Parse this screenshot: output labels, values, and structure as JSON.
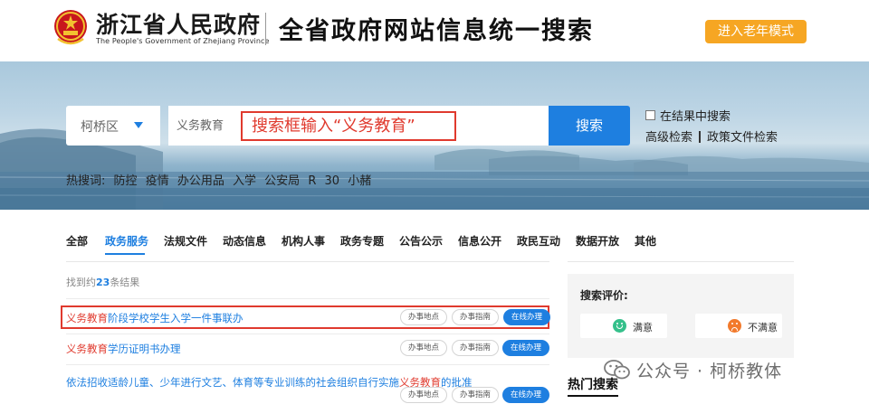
{
  "header": {
    "gov_name": "浙江省人民政府",
    "gov_name_en": "The People's Government of Zhejiang Province",
    "site_title": "全省政府网站信息统一搜索",
    "elder_mode_label": "进入老年模式"
  },
  "search": {
    "district": "柯桥区",
    "value": "义务教育",
    "annotation": "搜索框输入“义务教育”",
    "button_label": "搜索",
    "in_results_label": "在结果中搜索",
    "advanced_label": "高级检索",
    "policy_label": "政策文件检索"
  },
  "hot_words": {
    "label": "热搜词:",
    "items": [
      "防控",
      "疫情",
      "办公用品",
      "入学",
      "公安局",
      "R",
      "30",
      "小赭"
    ]
  },
  "tabs": {
    "items": [
      "全部",
      "政务服务",
      "法规文件",
      "动态信息",
      "机构人事",
      "政务专题",
      "公告公示",
      "信息公开",
      "政民互动",
      "数据开放",
      "其他"
    ],
    "active": "政务服务"
  },
  "results": {
    "count_prefix": "找到约",
    "count": "23",
    "count_suffix": "条结果",
    "items": [
      {
        "highlight": "义务教育",
        "rest": "阶段学校学生入学一件事联办",
        "before": ""
      },
      {
        "highlight": "义务教育",
        "rest": "学历证明书办理",
        "before": ""
      },
      {
        "highlight": "义务教育",
        "rest": "的批准",
        "before": "依法招收适龄儿童、少年进行文艺、体育等专业训练的社会组织自行实施"
      }
    ],
    "actions": [
      "办事地点",
      "办事指南",
      "在线办理"
    ]
  },
  "side": {
    "rating_title": "搜索评价:",
    "satisfied": "满意",
    "unsatisfied": "不满意",
    "hot_search_title": "热门搜索"
  },
  "watermark": "公众号 · 柯桥教体",
  "colors": {
    "accent": "#1e7fe0",
    "highlight": "#e03a2e",
    "elder_button": "#f6a623"
  }
}
